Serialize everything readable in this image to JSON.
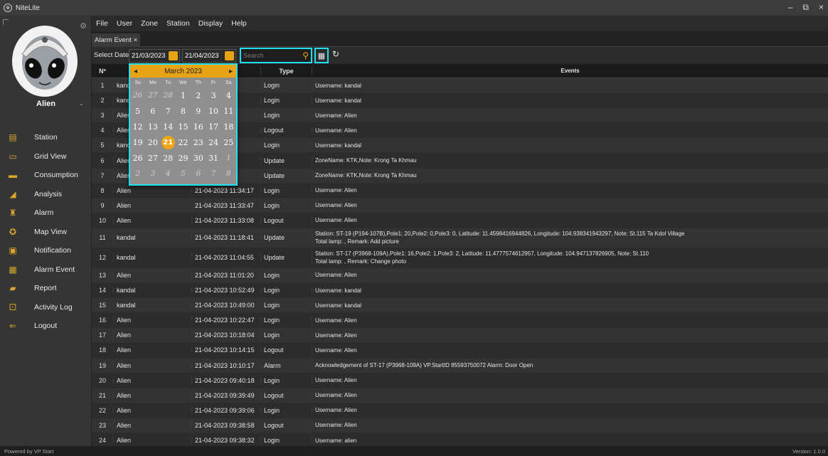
{
  "window": {
    "title": "NiteLite",
    "minimize": "–",
    "restore": "⧉",
    "close": "×"
  },
  "sidebar": {
    "user_name": "Alien",
    "items": [
      {
        "label": "Station",
        "icon": "station-icon"
      },
      {
        "label": "Grid View",
        "icon": "grid-view-icon"
      },
      {
        "label": "Consumption",
        "icon": "consumption-icon"
      },
      {
        "label": "Analysis",
        "icon": "analysis-icon"
      },
      {
        "label": "Alarm",
        "icon": "alarm-icon"
      },
      {
        "label": "Map View",
        "icon": "map-view-icon"
      },
      {
        "label": "Notification",
        "icon": "notification-icon"
      },
      {
        "label": "Alarm Event",
        "icon": "alarm-event-icon"
      },
      {
        "label": "Report",
        "icon": "report-icon"
      },
      {
        "label": "Activity Log",
        "icon": "activity-log-icon"
      },
      {
        "label": "Logout",
        "icon": "logout-icon"
      }
    ]
  },
  "menu": [
    "File",
    "User",
    "Zone",
    "Station",
    "Display",
    "Help"
  ],
  "tab": {
    "label": "Alarm Event",
    "close": "×"
  },
  "toolbar": {
    "select_date_label": "Select Date",
    "from_date": "21/03/2023",
    "to_date": "21/04/2023",
    "search_placeholder": "Search"
  },
  "table": {
    "headers": {
      "no": "Nº",
      "type": "Type",
      "events": "Events"
    },
    "rows": [
      {
        "no": "1",
        "user": "kandal",
        "time": ":53",
        "type": "Login",
        "event": "Username: kandal"
      },
      {
        "no": "2",
        "user": "kandal",
        "time": ":16",
        "type": "Login",
        "event": "Username: kandal"
      },
      {
        "no": "3",
        "user": "Alien",
        "time": ":29",
        "type": "Login",
        "event": "Username: Alien"
      },
      {
        "no": "4",
        "user": "Alien",
        "time": ":23",
        "type": "Logout",
        "event": "Username: Alien"
      },
      {
        "no": "5",
        "user": "kandal",
        "time": ":23",
        "type": "Login",
        "event": "Username: kandal"
      },
      {
        "no": "6",
        "user": "Alien",
        "time": ":25",
        "type": "Update",
        "event": "ZoneName: KTK,Note: Krong Ta Khmau"
      },
      {
        "no": "7",
        "user": "Alien",
        "time": ":18",
        "type": "Update",
        "event": "ZoneName: KTK,Note: Krong Ta Khmau"
      },
      {
        "no": "8",
        "user": "Alien",
        "time": "21-04-2023 11:34:17",
        "type": "Login",
        "event": "Username: Alien"
      },
      {
        "no": "9",
        "user": "Alien",
        "time": "21-04-2023 11:33:47",
        "type": "Login",
        "event": "Username: Alien"
      },
      {
        "no": "10",
        "user": "Alien",
        "time": "21-04-2023 11:33:08",
        "type": "Logout",
        "event": "Username: Alien"
      },
      {
        "no": "11",
        "user": "kandal",
        "time": "21-04-2023 11:18:41",
        "type": "Update",
        "event": "Station: ST-19 (P194-107B),Pole1: 20,Pole2: 0,Pole3: 0, Latitude: 11.4598416944826, Longitude: 104.938341943297, Note: St.115 Ta Kdol Village",
        "event2": "Total lamp: , Remark: Add picture"
      },
      {
        "no": "12",
        "user": "kandal",
        "time": "21-04-2023 11:04:55",
        "type": "Update",
        "event": "Station: ST-17 (P3968-109A),Pole1: 16,Pole2: 1,Pole3: 2, Latitude: 11.4777574612957, Longitude: 104.947137826905, Note: St.110",
        "event2": "Total lamp: , Remark: Change photo"
      },
      {
        "no": "13",
        "user": "Alien",
        "time": "21-04-2023 11:01:20",
        "type": "Login",
        "event": "Username: Alien"
      },
      {
        "no": "14",
        "user": "kandal",
        "time": "21-04-2023 10:52:49",
        "type": "Login",
        "event": "Username: kandal"
      },
      {
        "no": "15",
        "user": "kandal",
        "time": "21-04-2023 10:49:00",
        "type": "Login",
        "event": "Username: kandal"
      },
      {
        "no": "16",
        "user": "Alien",
        "time": "21-04-2023 10:22:47",
        "type": "Login",
        "event": "Username: Alien"
      },
      {
        "no": "17",
        "user": "Alien",
        "time": "21-04-2023 10:18:04",
        "type": "Login",
        "event": "Username: Alien"
      },
      {
        "no": "18",
        "user": "Alien",
        "time": "21-04-2023 10:14:15",
        "type": "Logout",
        "event": "Username: Alien"
      },
      {
        "no": "19",
        "user": "Alien",
        "time": "21-04-2023 10:10:17",
        "type": "Alarm",
        "event": "Acknowledgement of ST-17 (P3968-109A) VP.StartID 85593750072 Alarm: Door Open"
      },
      {
        "no": "20",
        "user": "Alien",
        "time": "21-04-2023 09:40:18",
        "type": "Login",
        "event": "Username: Alien"
      },
      {
        "no": "21",
        "user": "Alien",
        "time": "21-04-2023 09:39:49",
        "type": "Logout",
        "event": "Username: Alien"
      },
      {
        "no": "22",
        "user": "Alien",
        "time": "21-04-2023 09:39:06",
        "type": "Login",
        "event": "Username: Alien"
      },
      {
        "no": "23",
        "user": "Alien",
        "time": "21-04-2023 09:38:58",
        "type": "Logout",
        "event": "Username: Alien"
      },
      {
        "no": "24",
        "user": "Alien",
        "time": "21-04-2023 09:38:32",
        "type": "Login",
        "event": "Username: alien"
      }
    ]
  },
  "calendar": {
    "month": "March 2023",
    "prev": "◂",
    "next": "▸",
    "dow": [
      "Su",
      "Mo",
      "Tu",
      "We",
      "Th",
      "Fr",
      "Sa"
    ],
    "days": [
      {
        "d": "26",
        "o": true
      },
      {
        "d": "27",
        "o": true
      },
      {
        "d": "28",
        "o": true
      },
      {
        "d": "1"
      },
      {
        "d": "2"
      },
      {
        "d": "3"
      },
      {
        "d": "4"
      },
      {
        "d": "5"
      },
      {
        "d": "6"
      },
      {
        "d": "7"
      },
      {
        "d": "8"
      },
      {
        "d": "9"
      },
      {
        "d": "10"
      },
      {
        "d": "11"
      },
      {
        "d": "12"
      },
      {
        "d": "13"
      },
      {
        "d": "14"
      },
      {
        "d": "15"
      },
      {
        "d": "16"
      },
      {
        "d": "17"
      },
      {
        "d": "18"
      },
      {
        "d": "19"
      },
      {
        "d": "20"
      },
      {
        "d": "21",
        "sel": true
      },
      {
        "d": "22"
      },
      {
        "d": "23"
      },
      {
        "d": "24"
      },
      {
        "d": "25"
      },
      {
        "d": "26"
      },
      {
        "d": "27"
      },
      {
        "d": "28"
      },
      {
        "d": "29"
      },
      {
        "d": "30"
      },
      {
        "d": "31"
      },
      {
        "d": "1",
        "o": true
      },
      {
        "d": "2",
        "o": true
      },
      {
        "d": "3",
        "o": true
      },
      {
        "d": "4",
        "o": true
      },
      {
        "d": "5",
        "o": true
      },
      {
        "d": "6",
        "o": true
      },
      {
        "d": "7",
        "o": true
      },
      {
        "d": "8",
        "o": true
      }
    ]
  },
  "status": {
    "left": "Powered by VP Start",
    "right": "Version: 1.0.0"
  },
  "colors": {
    "accent": "#e8a317",
    "highlight": "#1ee0f0"
  }
}
